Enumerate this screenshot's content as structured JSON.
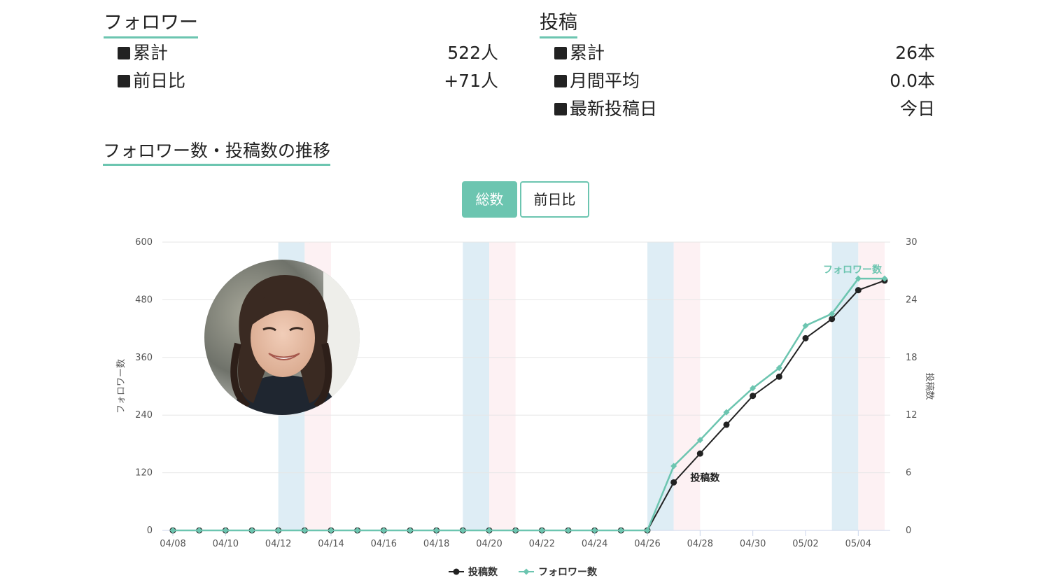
{
  "followers": {
    "title": "フォロワー",
    "rows": [
      {
        "label": "累計",
        "value": "522人"
      },
      {
        "label": "前日比",
        "value": "+71人"
      }
    ]
  },
  "posts": {
    "title": "投稿",
    "rows": [
      {
        "label": "累計",
        "value": "26本"
      },
      {
        "label": "月間平均",
        "value": "0.0本"
      },
      {
        "label": "最新投稿日",
        "value": "今日"
      }
    ]
  },
  "chart_section": {
    "title": "フォロワー数・投稿数の推移",
    "toggle": {
      "total_label": "総数",
      "diff_label": "前日比",
      "active": "total"
    }
  },
  "colors": {
    "accent": "#6cc5b0",
    "posts_line": "#222222",
    "weekend_blue": "#deedf5",
    "weekend_pink": "#fdf1f3"
  },
  "chart_data": {
    "type": "line",
    "x": [
      "04/08",
      "04/09",
      "04/10",
      "04/11",
      "04/12",
      "04/13",
      "04/14",
      "04/15",
      "04/16",
      "04/17",
      "04/18",
      "04/19",
      "04/20",
      "04/21",
      "04/22",
      "04/23",
      "04/24",
      "04/25",
      "04/26",
      "04/27",
      "04/28",
      "04/29",
      "04/30",
      "05/01",
      "05/02",
      "05/03",
      "05/04",
      "05/05"
    ],
    "x_tick_labels": [
      "04/08",
      "04/10",
      "04/12",
      "04/14",
      "04/16",
      "04/18",
      "04/20",
      "04/22",
      "04/24",
      "04/26",
      "04/28",
      "04/30",
      "05/02",
      "05/04"
    ],
    "ylabel_left": "フォロワー数",
    "ylabel_right": "投稿数",
    "ylim_left": [
      0,
      600
    ],
    "ylim_right": [
      0,
      30
    ],
    "yticks_left": [
      0,
      120,
      240,
      360,
      480,
      600
    ],
    "yticks_right": [
      0,
      6,
      12,
      18,
      24,
      30
    ],
    "weekend_bands": [
      {
        "day": "04/12",
        "kind": "sat"
      },
      {
        "day": "04/13",
        "kind": "sun"
      },
      {
        "day": "04/19",
        "kind": "sat"
      },
      {
        "day": "04/20",
        "kind": "sun"
      },
      {
        "day": "04/26",
        "kind": "sat"
      },
      {
        "day": "04/27",
        "kind": "sun"
      },
      {
        "day": "05/03",
        "kind": "sat"
      },
      {
        "day": "05/04",
        "kind": "sun"
      }
    ],
    "series": [
      {
        "name": "投稿数",
        "axis": "right",
        "marker": "circle",
        "color": "#222222",
        "values": [
          0,
          0,
          0,
          0,
          0,
          0,
          0,
          0,
          0,
          0,
          0,
          0,
          0,
          0,
          0,
          0,
          0,
          0,
          0,
          5,
          8,
          11,
          14,
          16,
          20,
          22,
          25,
          26
        ]
      },
      {
        "name": "フォロワー数",
        "axis": "left",
        "marker": "diamond",
        "color": "#6cc5b0",
        "values": [
          0,
          0,
          0,
          0,
          0,
          0,
          0,
          0,
          0,
          0,
          0,
          0,
          0,
          0,
          0,
          0,
          0,
          0,
          0,
          134,
          188,
          246,
          296,
          338,
          426,
          451,
          524,
          524
        ]
      }
    ],
    "legend": "bottom-center",
    "grid": true
  }
}
